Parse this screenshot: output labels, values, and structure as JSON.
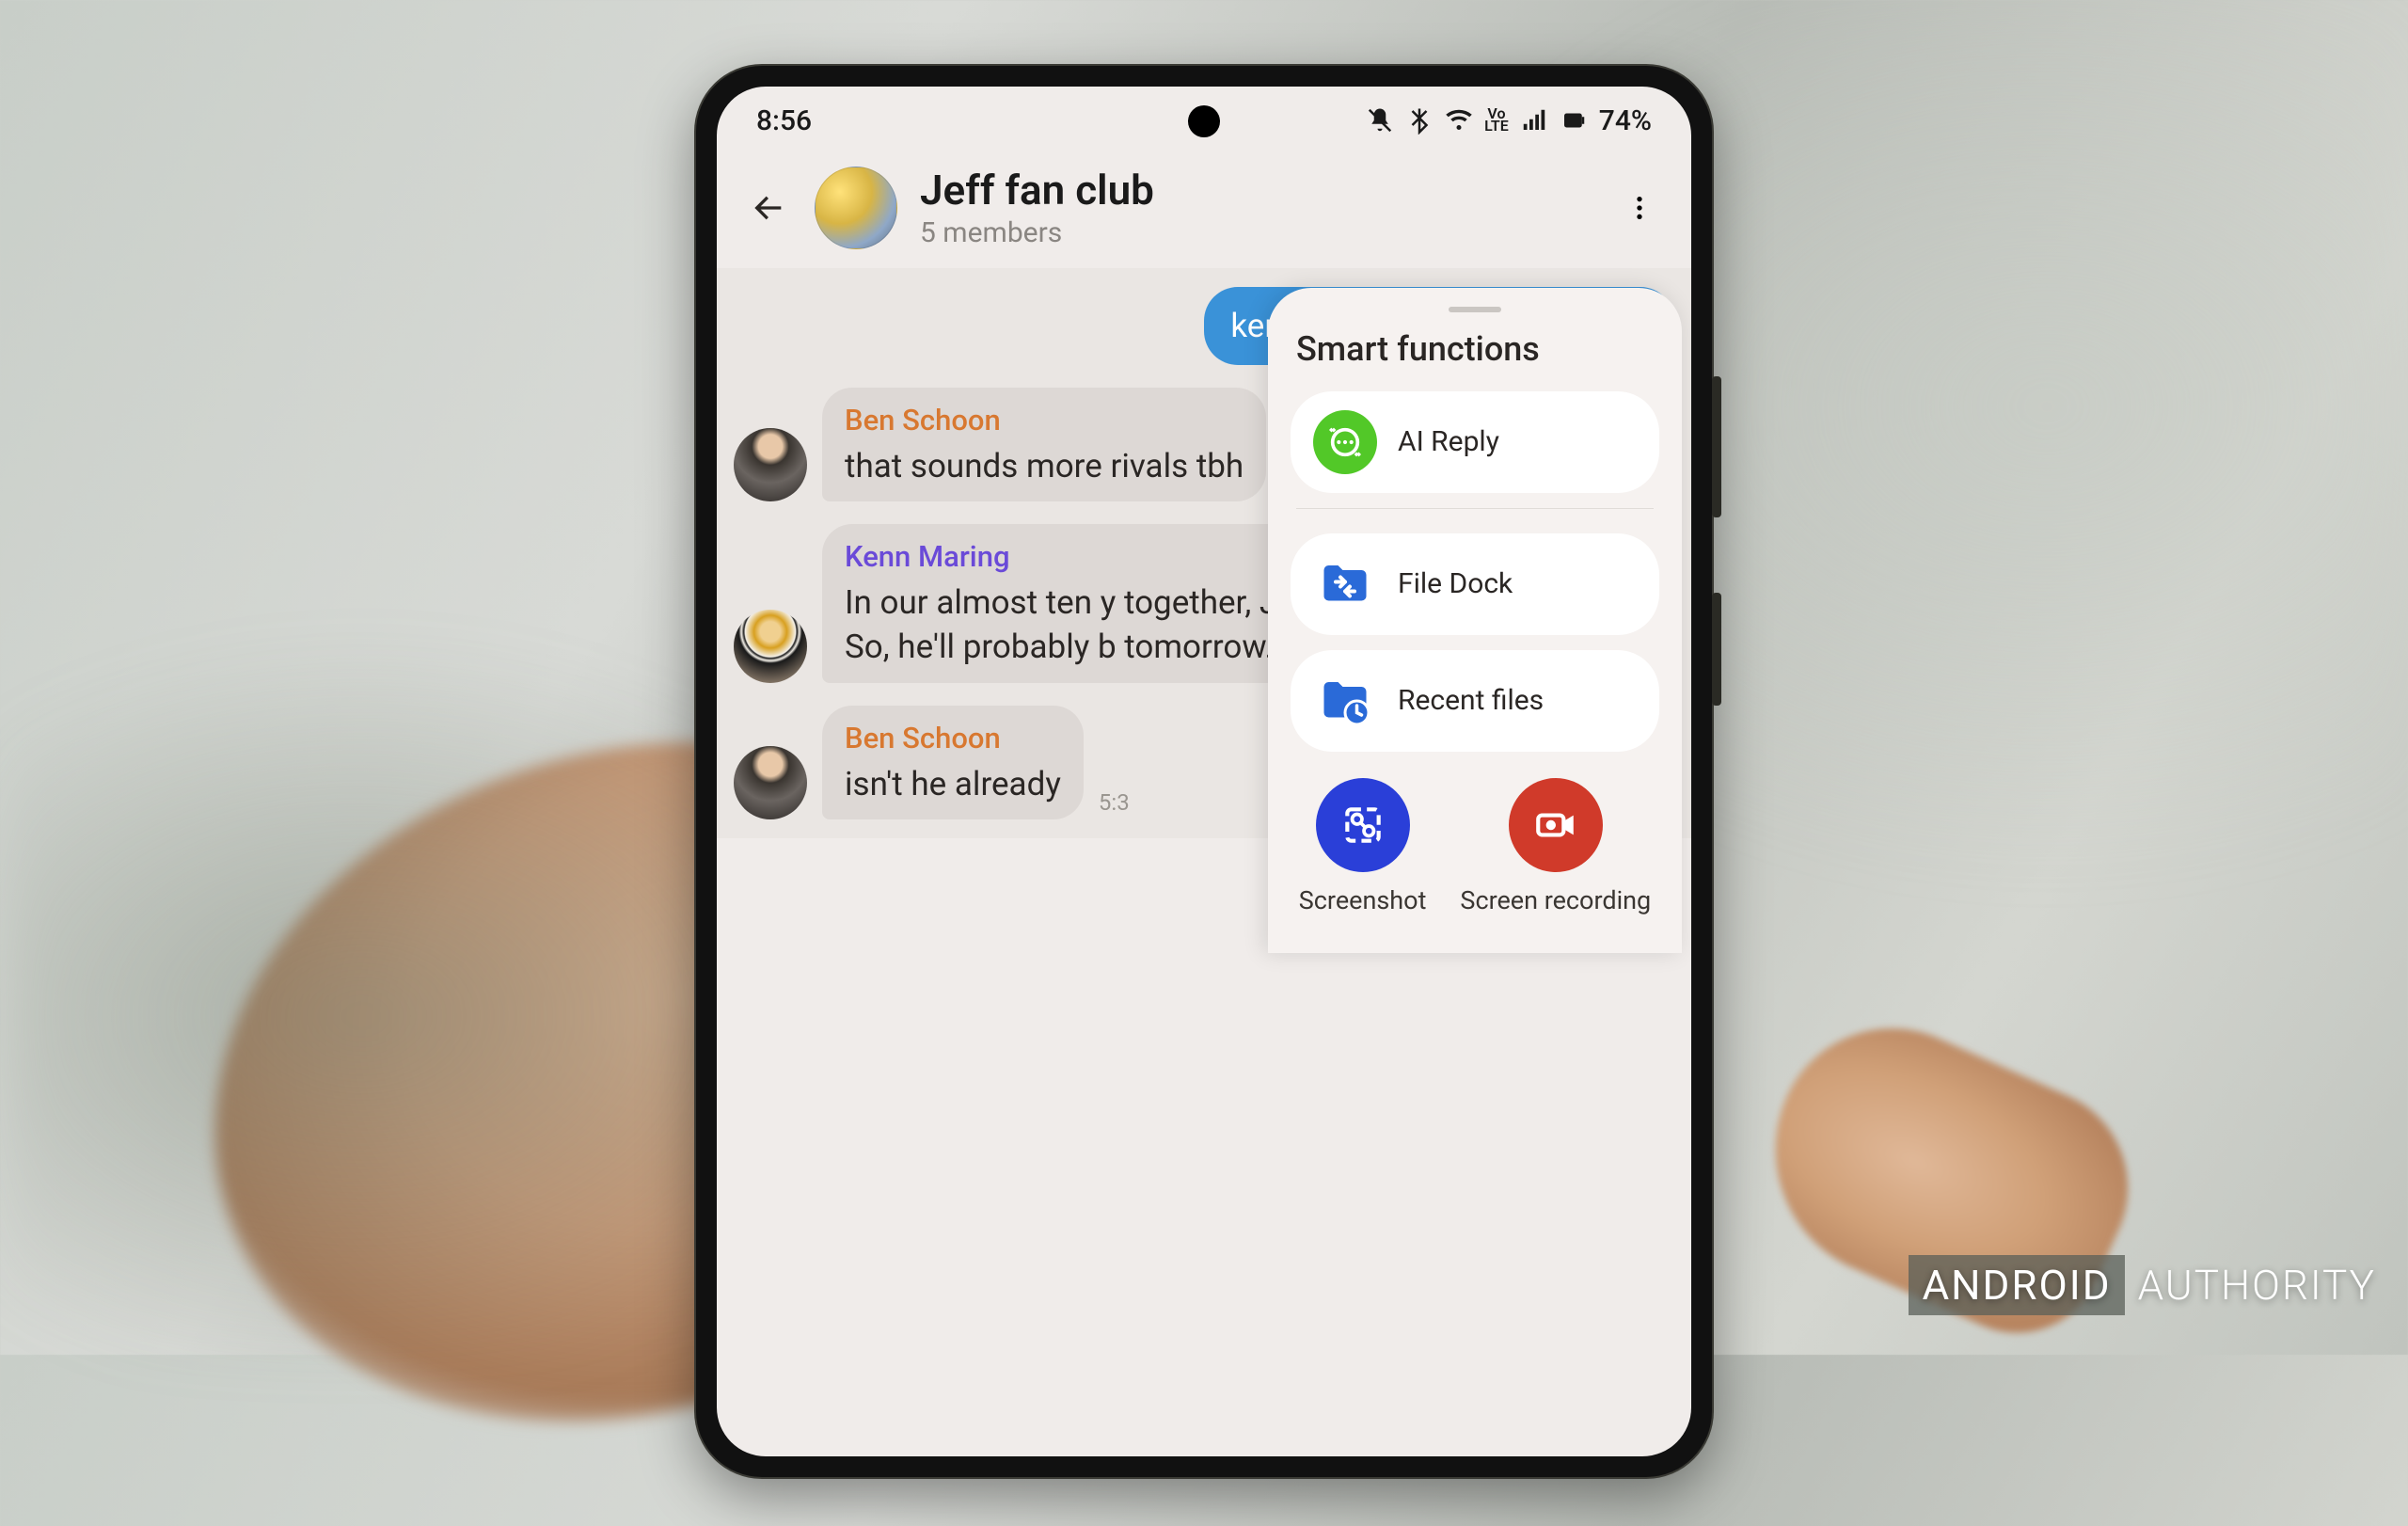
{
  "statusbar": {
    "time": "8:56",
    "battery_pct": "74%"
  },
  "header": {
    "title": "Jeff fan club",
    "subtitle": "5 members"
  },
  "messages": {
    "outgoing1": "kenn and i discussed tonight",
    "ben1_sender": "Ben Schoon",
    "ben1_text": "that sounds more rivals tbh",
    "kenn_sender": "Kenn Maring",
    "kenn_text": "In our almost ten y together, Joe has v So, he'll probably b tomorrow.",
    "ben2_sender": "Ben Schoon",
    "ben2_text": "isn't he already",
    "ben2_time": "5:3"
  },
  "panel": {
    "title": "Smart functions",
    "ai_reply": "AI Reply",
    "file_dock": "File Dock",
    "recent_files": "Recent files",
    "screenshot": "Screenshot",
    "screen_recording": "Screen recording"
  },
  "watermark": {
    "brand1": "ANDROID",
    "brand2": "AUTHORITY"
  }
}
